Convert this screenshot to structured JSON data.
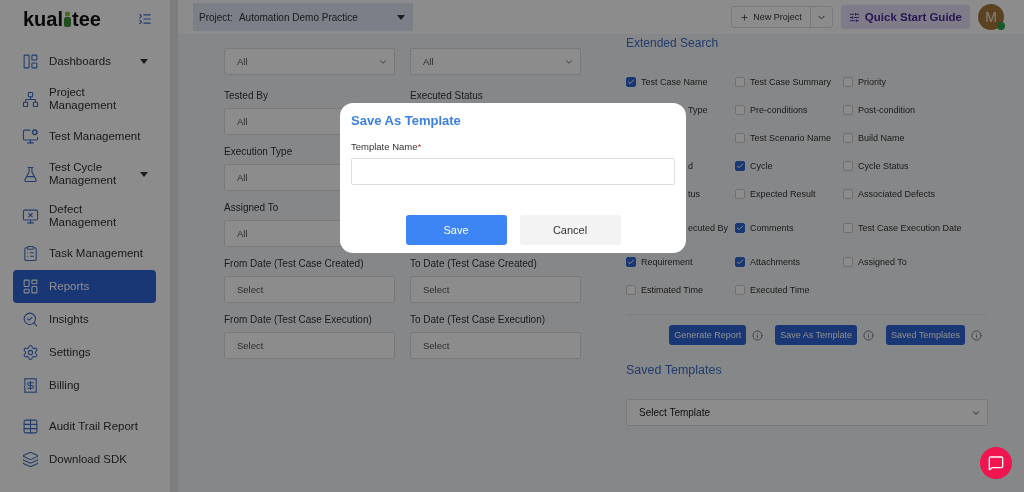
{
  "logo": {
    "text_start": "kual",
    "text_end": "tee"
  },
  "sidebar": {
    "items": [
      {
        "label": "Dashboards",
        "expandable": true,
        "selected": false
      },
      {
        "label": "Project Management",
        "expandable": false,
        "selected": false
      },
      {
        "label": "Test Management",
        "expandable": false,
        "selected": false
      },
      {
        "label": "Test Cycle Management",
        "expandable": true,
        "selected": false
      },
      {
        "label": "Defect Management",
        "expandable": false,
        "selected": false
      },
      {
        "label": "Task Management",
        "expandable": false,
        "selected": false
      },
      {
        "label": "Reports",
        "expandable": false,
        "selected": true
      },
      {
        "label": "Insights",
        "expandable": false,
        "selected": false
      },
      {
        "label": "Settings",
        "expandable": false,
        "selected": false
      },
      {
        "label": "Billing",
        "expandable": false,
        "selected": false
      }
    ],
    "bottom_items": [
      {
        "label": "Audit Trail Report",
        "selected": false
      },
      {
        "label": "Download SDK",
        "selected": false
      }
    ]
  },
  "header": {
    "project_label": "Project:",
    "project_value": "Automation Demo Practice",
    "new_project": "New Project",
    "quick_start": "Quick Start Guide",
    "avatar": "M"
  },
  "form": {
    "rows": [
      {
        "left": {
          "kind": "dropdown",
          "value": "All"
        },
        "right": {
          "kind": "dropdown",
          "value": "All"
        }
      },
      {
        "left": {
          "label": "Tested By",
          "kind": "input",
          "value": "All"
        },
        "right": {
          "label": "Executed Status"
        }
      },
      {
        "left": {
          "label": "Execution Type",
          "kind": "input",
          "value": "All"
        }
      },
      {
        "left": {
          "label": "Assigned To",
          "kind": "input",
          "value": "All"
        }
      },
      {
        "left": {
          "label": "From Date (Test Case Created)",
          "kind": "input",
          "value": "Select"
        },
        "right": {
          "label": "To Date (Test Case Created)",
          "kind": "input",
          "value": "Select"
        }
      },
      {
        "left": {
          "label": "From Date (Test Case Execution)",
          "kind": "input",
          "value": "Select"
        },
        "right": {
          "label": "To Date (Test Case Execution)",
          "kind": "input",
          "value": "Select"
        }
      }
    ]
  },
  "extended_search": {
    "title": "Extended Search",
    "columns": [
      [
        {
          "kind": "full",
          "label": "Test Case Name",
          "checked": true
        },
        {
          "kind": "partial",
          "label": "Type"
        },
        {
          "kind": "hidden"
        },
        {
          "kind": "partial",
          "label": "d"
        },
        {
          "kind": "partial",
          "label": "tus"
        },
        {
          "kind": "partial",
          "label": "ecuted By"
        },
        {
          "kind": "full",
          "label": "Requirement",
          "checked": true
        },
        {
          "kind": "full",
          "label": "Estimated Time",
          "checked": false
        }
      ],
      [
        {
          "kind": "full",
          "label": "Test Case Summary",
          "checked": false
        },
        {
          "kind": "full",
          "label": "Pre-conditions",
          "checked": false
        },
        {
          "kind": "full",
          "label": "Test Scenario Name",
          "checked": false
        },
        {
          "kind": "full",
          "label": "Cycle",
          "checked": true
        },
        {
          "kind": "full",
          "label": "Expected Result",
          "checked": false
        },
        {
          "kind": "full",
          "label": "Comments",
          "checked": true
        },
        {
          "kind": "full",
          "label": "Attachments",
          "checked": true
        },
        {
          "kind": "full",
          "label": "Executed Time",
          "checked": false
        }
      ],
      [
        {
          "kind": "full",
          "label": "Priority",
          "checked": false
        },
        {
          "kind": "full",
          "label": "Post-condition",
          "checked": false
        },
        {
          "kind": "full",
          "label": "Build Name",
          "checked": false
        },
        {
          "kind": "full",
          "label": "Cycle Status",
          "checked": false
        },
        {
          "kind": "full",
          "label": "Associated Defects",
          "checked": false
        },
        {
          "kind": "full",
          "label": "Test Case Execution Date",
          "checked": false
        },
        {
          "kind": "full",
          "label": "Assigned To",
          "checked": false
        }
      ]
    ],
    "buttons": [
      "Generate Report",
      "Save As Template",
      "Saved Templates"
    ]
  },
  "saved_templates": {
    "title": "Saved Templates",
    "placeholder": "Select Template"
  },
  "modal": {
    "title": "Save As Template",
    "field_label": "Template Name",
    "required_mark": "*",
    "save": "Save",
    "cancel": "Cancel"
  }
}
